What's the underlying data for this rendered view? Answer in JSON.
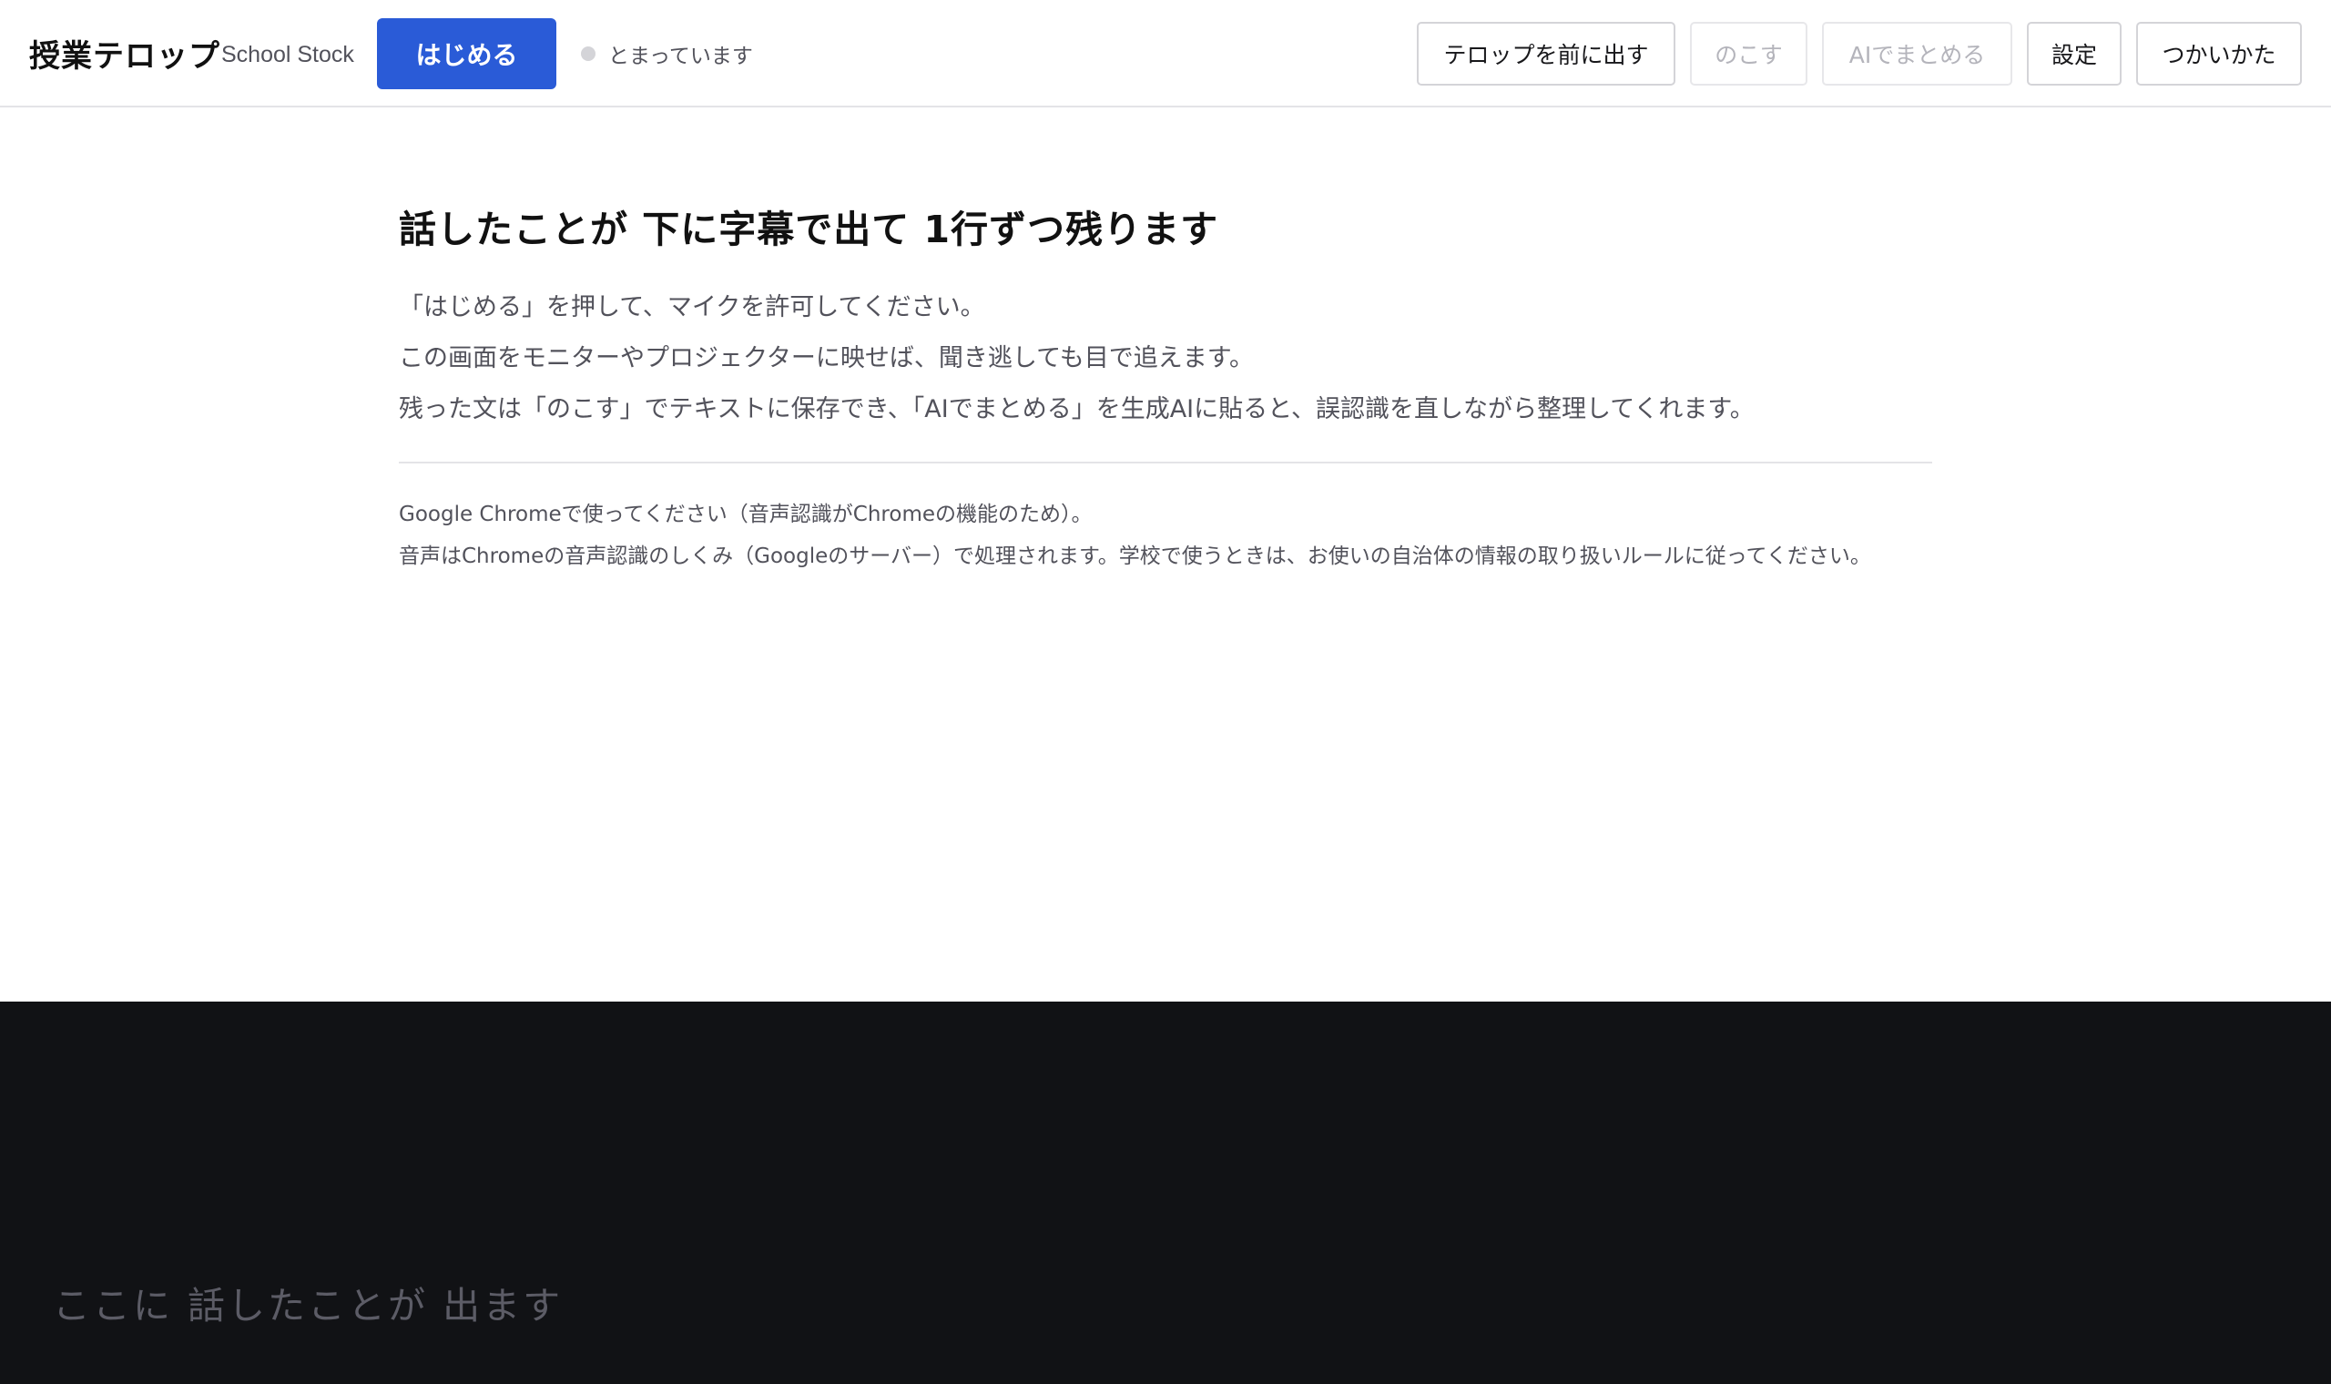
{
  "header": {
    "app_title": "授業テロップ",
    "app_subtitle": "School Stock",
    "start_button": "はじめる",
    "status_text": "とまっています",
    "buttons": {
      "bring_front": "テロップを前に出す",
      "save": "のこす",
      "ai_summarize": "AIでまとめる",
      "settings": "設定",
      "howto": "つかいかた"
    }
  },
  "intro": {
    "title": "話したことが 下に字幕で出て 1行ずつ残ります",
    "lines": [
      "「はじめる」を押して、マイクを許可してください。",
      "この画面をモニターやプロジェクターに映せば、聞き逃しても目で追えます。",
      "残った文は「のこす」でテキストに保存でき、「AIでまとめる」を生成AIに貼ると、誤認識を直しながら整理してくれます。"
    ],
    "notes": [
      "Google Chromeで使ってください（音声認識がChromeの機能のため）。",
      "音声はChromeの音声認識のしくみ（Googleのサーバー）で処理されます。学校で使うときは、お使いの自治体の情報の取り扱いルールに従ってください。"
    ]
  },
  "caption": {
    "placeholder": "ここに 話したことが 出ます"
  },
  "colors": {
    "accent": "#2a5bd7",
    "caption_background": "#111215",
    "status_idle": "#d4d4d8"
  }
}
